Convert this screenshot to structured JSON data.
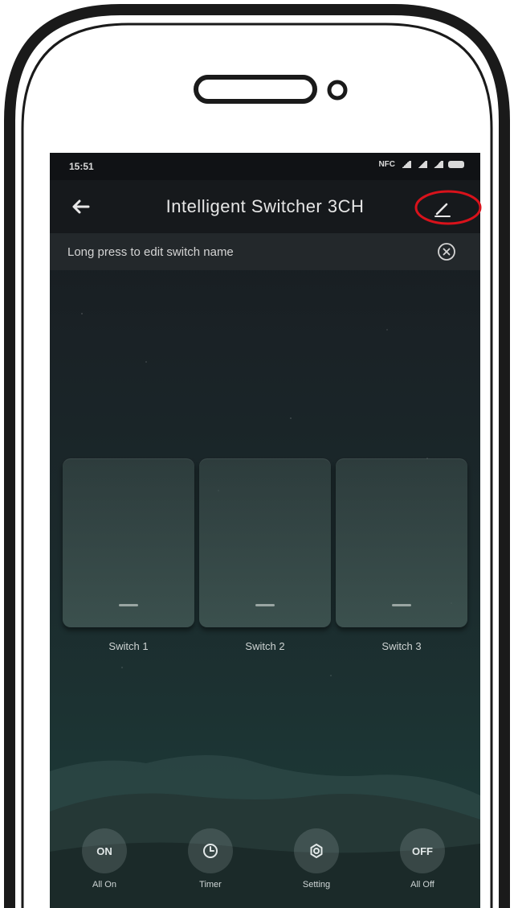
{
  "status_bar": {
    "time": "15:51",
    "indicators": "NFC"
  },
  "header": {
    "back_icon": "arrow-left-icon",
    "title": "Intelligent Switcher 3CH",
    "edit_icon": "pencil-icon",
    "highlight_color": "#d8121b"
  },
  "hint": {
    "text": "Long press to edit switch name",
    "close_icon": "close-circle-icon"
  },
  "switches": [
    {
      "label": "Switch 1"
    },
    {
      "label": "Switch 2"
    },
    {
      "label": "Switch 3"
    }
  ],
  "bottom_actions": [
    {
      "icon_text": "ON",
      "label": "All On"
    },
    {
      "icon": "clock-icon",
      "label": "Timer"
    },
    {
      "icon": "gear-icon",
      "label": "Setting"
    },
    {
      "icon_text": "OFF",
      "label": "All Off"
    }
  ]
}
